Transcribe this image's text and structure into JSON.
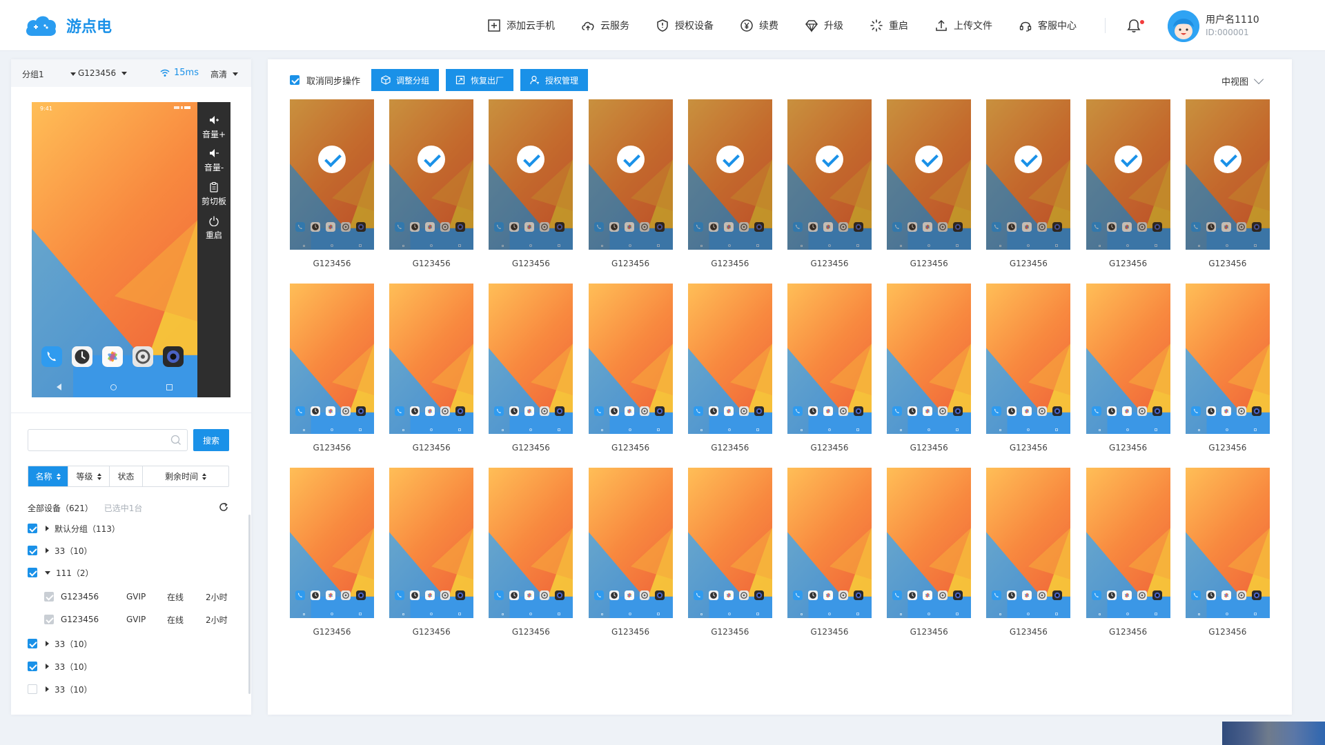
{
  "app": {
    "logo_text": "游点电"
  },
  "nav": {
    "items": [
      {
        "label": "添加云手机",
        "icon": "plus-square-icon"
      },
      {
        "label": "云服务",
        "icon": "cloud-upload-icon"
      },
      {
        "label": "授权设备",
        "icon": "shield-icon"
      },
      {
        "label": "续费",
        "icon": "yen-icon"
      },
      {
        "label": "升级",
        "icon": "diamond-icon"
      },
      {
        "label": "重启",
        "icon": "loading-icon"
      },
      {
        "label": "上传文件",
        "icon": "upload-icon"
      },
      {
        "label": "客服中心",
        "icon": "headset-icon"
      }
    ]
  },
  "user": {
    "name": "用户名1110",
    "id": "ID:000001"
  },
  "device_bar": {
    "group": "分组1",
    "device": "G123456",
    "latency": "15ms",
    "quality": "高清"
  },
  "preview": {
    "status_time": "9:41",
    "controls": [
      {
        "label": "音量+",
        "icon": "volume-up-icon"
      },
      {
        "label": "音量-",
        "icon": "volume-down-icon"
      },
      {
        "label": "剪切板",
        "icon": "clipboard-icon"
      },
      {
        "label": "重启",
        "icon": "power-icon"
      }
    ]
  },
  "search": {
    "placeholder": "",
    "button": "搜索"
  },
  "sort": [
    {
      "label": "名称",
      "active": true
    },
    {
      "label": "等级",
      "active": false
    },
    {
      "label": "状态",
      "active": false
    },
    {
      "label": "剩余时间",
      "active": false
    }
  ],
  "device_summary": {
    "all": "全部设备（621）",
    "selected": "已选中1台"
  },
  "tree": [
    {
      "type": "group",
      "label": "默认分组（113）",
      "checked": true,
      "expanded": false
    },
    {
      "type": "group",
      "label": "33（10）",
      "checked": true,
      "expanded": false
    },
    {
      "type": "group",
      "label": "111（2）",
      "checked": true,
      "expanded": true
    },
    {
      "type": "device",
      "name": "G123456",
      "level": "GVIP",
      "status": "在线",
      "time": "2小时"
    },
    {
      "type": "device",
      "name": "G123456",
      "level": "GVIP",
      "status": "在线",
      "time": "2小时"
    },
    {
      "type": "group",
      "label": "33（10）",
      "checked": true,
      "expanded": false
    },
    {
      "type": "group",
      "label": "33（10）",
      "checked": true,
      "expanded": false
    },
    {
      "type": "group",
      "label": "33（10）",
      "checked": false,
      "expanded": false
    }
  ],
  "toolbar": {
    "cancel_sync": "取消同步操作",
    "cancel_sync_checked": true,
    "buttons": [
      {
        "label": "调整分组",
        "icon": "cube-icon"
      },
      {
        "label": "恢复出厂",
        "icon": "reset-icon"
      },
      {
        "label": "授权管理",
        "icon": "user-key-icon"
      }
    ],
    "view": "中视图"
  },
  "devices": [
    {
      "label": "G123456",
      "selected": true
    },
    {
      "label": "G123456",
      "selected": true
    },
    {
      "label": "G123456",
      "selected": true
    },
    {
      "label": "G123456",
      "selected": true
    },
    {
      "label": "G123456",
      "selected": true
    },
    {
      "label": "G123456",
      "selected": true
    },
    {
      "label": "G123456",
      "selected": true
    },
    {
      "label": "G123456",
      "selected": true
    },
    {
      "label": "G123456",
      "selected": true
    },
    {
      "label": "G123456",
      "selected": true
    },
    {
      "label": "G123456",
      "selected": false
    },
    {
      "label": "G123456",
      "selected": false
    },
    {
      "label": "G123456",
      "selected": false
    },
    {
      "label": "G123456",
      "selected": false
    },
    {
      "label": "G123456",
      "selected": false
    },
    {
      "label": "G123456",
      "selected": false
    },
    {
      "label": "G123456",
      "selected": false
    },
    {
      "label": "G123456",
      "selected": false
    },
    {
      "label": "G123456",
      "selected": false
    },
    {
      "label": "G123456",
      "selected": false
    },
    {
      "label": "G123456",
      "selected": false
    },
    {
      "label": "G123456",
      "selected": false
    },
    {
      "label": "G123456",
      "selected": false
    },
    {
      "label": "G123456",
      "selected": false
    },
    {
      "label": "G123456",
      "selected": false
    },
    {
      "label": "G123456",
      "selected": false
    },
    {
      "label": "G123456",
      "selected": false
    },
    {
      "label": "G123456",
      "selected": false
    },
    {
      "label": "G123456",
      "selected": false
    },
    {
      "label": "G123456",
      "selected": false
    }
  ],
  "colors": {
    "accent": "#1a91e8",
    "panel_bg": "#eef2f7",
    "sidebar_dark": "#2e2e2e",
    "notification_dot": "#f23b3b"
  }
}
